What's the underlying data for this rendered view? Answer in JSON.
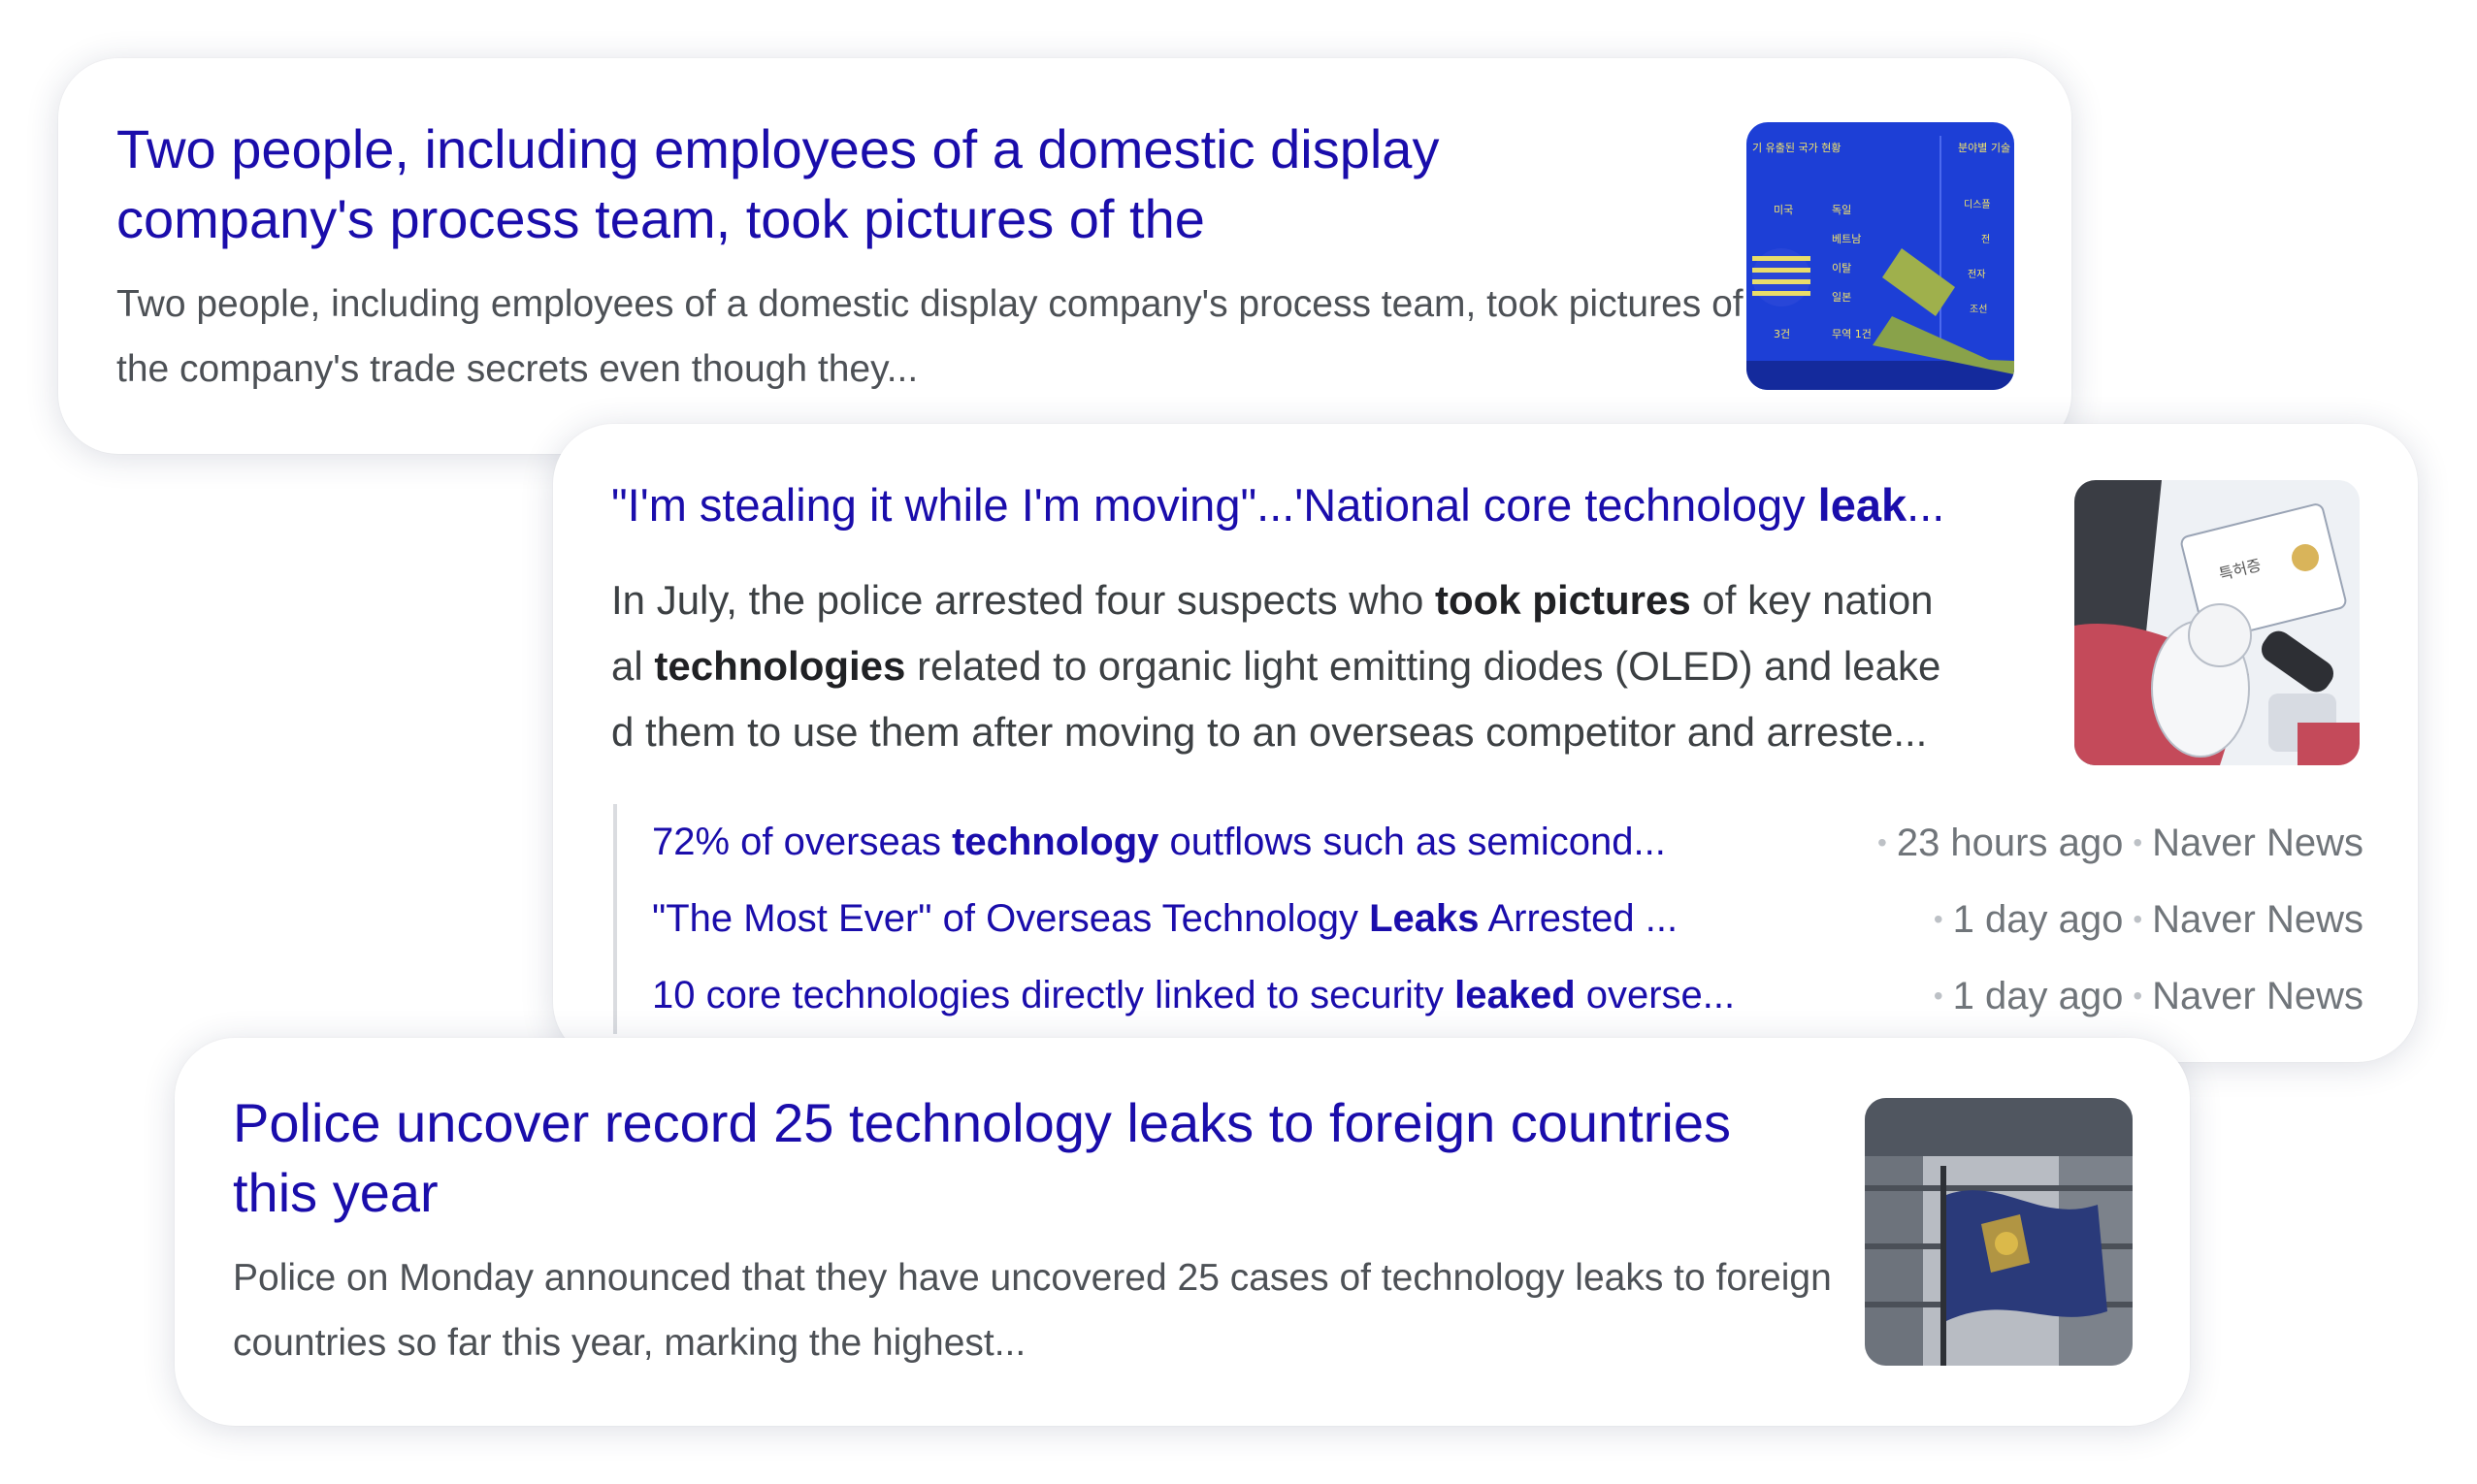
{
  "results": [
    {
      "title": "Two people, including employees of a domestic display company's process team, took pictures of the",
      "snippet": "Two people, including employees of a domestic display company's process team, took pictures of the company's trade secrets even though they...",
      "thumbnail": {
        "row_labels": [
          "미국",
          "독일",
          "베트남",
          "이탈",
          "일본",
          "3건",
          "무역 1건"
        ],
        "header_left": "기 유출된 국가 현황",
        "header_right": "분야별 기술 유",
        "right_labels": [
          "디스플",
          "전",
          "전자",
          "조선"
        ],
        "colors": {
          "background": "#1d3fd6",
          "accent": "#e8d94a"
        }
      }
    },
    {
      "title_parts": [
        {
          "text": "\"I'm stealing it while I'm moving\"...'National core technology ",
          "bold": false
        },
        {
          "text": "leak",
          "bold": true
        },
        {
          "text": "...",
          "bold": false
        }
      ],
      "snippet_lines": [
        [
          {
            "text": "In July, the police arrested four suspects who ",
            "bold": false
          },
          {
            "text": "took pictures",
            "bold": true
          },
          {
            "text": " of key nation",
            "bold": false
          }
        ],
        [
          {
            "text": "al ",
            "bold": false
          },
          {
            "text": "technologies",
            "bold": true
          },
          {
            "text": " related to organic light emitting diodes (OLED) and leake",
            "bold": false
          }
        ],
        [
          {
            "text": "d them to use them after moving to an overseas competitor and arreste...",
            "bold": false
          }
        ]
      ],
      "thumbnail": {
        "card_text": "특허증"
      },
      "related": [
        {
          "parts": [
            {
              "text": "72% of overseas ",
              "bold": false
            },
            {
              "text": "technology",
              "bold": true
            },
            {
              "text": " outflows such as semicond...",
              "bold": false
            }
          ],
          "time": "23 hours ago",
          "source": "Naver News"
        },
        {
          "parts": [
            {
              "text": "\"The Most Ever\" of Overseas Technology ",
              "bold": false
            },
            {
              "text": "Leaks",
              "bold": true
            },
            {
              "text": " Arrested ...",
              "bold": false
            }
          ],
          "time": "1 day ago",
          "source": "Naver News"
        },
        {
          "parts": [
            {
              "text": "10 core technologies directly linked to security ",
              "bold": false
            },
            {
              "text": "leaked",
              "bold": true
            },
            {
              "text": " overse...",
              "bold": false
            }
          ],
          "time": "1 day ago",
          "source": "Naver News"
        }
      ]
    },
    {
      "title": "Police uncover record 25 technology leaks to foreign countries this year",
      "snippet": "Police on Monday announced that they have uncovered 25 cases of technology leaks to foreign countries so far this year, marking the highest...",
      "thumbnail": {
        "colors": {
          "flag": "#2a3a7a",
          "sky": "#c9cdd3"
        }
      }
    }
  ],
  "colors": {
    "link": "#1a0dab",
    "snippet": "#4d5156",
    "meta": "#70757a"
  }
}
